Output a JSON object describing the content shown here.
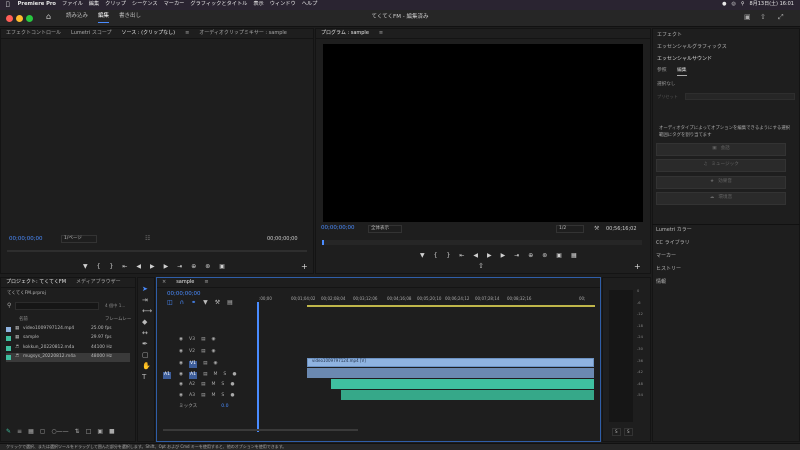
{
  "menubar": {
    "app_name": "Premiere Pro",
    "items": [
      "ファイル",
      "編集",
      "クリップ",
      "シーケンス",
      "マーカー",
      "グラフィックとタイトル",
      "表示",
      "ウィンドウ",
      "ヘルプ"
    ],
    "clock": "8月13日(土) 16:01"
  },
  "titlebar": {
    "tabs": [
      "読み込み",
      "編集",
      "書き出し"
    ],
    "active_tab": "編集",
    "doc_title": "てくてくFM - 編集済み"
  },
  "source_panel": {
    "tabs": [
      "エフェクトコントロール",
      "Lumetri スコープ",
      "ソース : (クリップなし)",
      "オーディオクリップミキサー : sample"
    ],
    "timecode_left": "00;00;00;00",
    "zoom": "1/ページ",
    "timecode_right": "00;00;00;00"
  },
  "program_panel": {
    "tab": "プログラム : sample",
    "timecode_left": "00;00;00;00",
    "fit": "全体表示",
    "resolution": "1/2",
    "timecode_right": "00;56;16;02"
  },
  "right_panel": {
    "headers": [
      "エフェクト",
      "エッセンシャルグラフィックス",
      "エッセンシャルサウンド"
    ],
    "subtabs": [
      "参照",
      "編集"
    ],
    "selection": "選択なし",
    "preset_label": "プリセット",
    "message": "オーディオタイプによってオプションを編集できるようにする選択範囲にタグを割り当てます",
    "buttons": [
      "会話",
      "ミュージック",
      "効果音",
      "環境音"
    ],
    "lower_panels": [
      "Lumetri カラー",
      "CC ライブラリ",
      "マーカー",
      "ヒストリー",
      "情報"
    ]
  },
  "project_panel": {
    "tabs": [
      "プロジェクト: てくてくFM",
      "メディアブラウザー"
    ],
    "file": "てくてくFM.prproj",
    "item_count": "4 個中 1...",
    "columns": [
      "名前",
      "フレームレー"
    ],
    "items": [
      {
        "name": "video1009797124.mp4",
        "rate": "25.00 fps",
        "color": "#8fb3e0"
      },
      {
        "name": "sample",
        "rate": "29.97 fps",
        "color": "#3fc0a0"
      },
      {
        "name": "kokkun_20220812.m4a",
        "rate": "44100 Hz",
        "color": "#3fc0a0"
      },
      {
        "name": "mugsys_20220812.m4a",
        "rate": "48000 Hz",
        "color": "#3fc0a0"
      }
    ]
  },
  "timeline": {
    "tab": "sample",
    "timecode": "00;00;00;00",
    "ruler": [
      ":00;00",
      "00;02;08;04",
      "00;04;16;08",
      "00;06;24;12",
      "00;08;32;16",
      "00;"
    ],
    "ruler_mid": [
      "00;01;04;02",
      "00;03;12;06",
      "00;05;20;10",
      "00;07;28;14"
    ],
    "video_tracks": [
      "V3",
      "V2",
      "V1"
    ],
    "audio_tracks": [
      "A1",
      "A2",
      "A3"
    ],
    "source_patch": [
      "V1",
      "A1"
    ],
    "mix_label": "ミックス",
    "mix_value": "0.0",
    "clip_name": "video1009797124.mp4 [V]"
  },
  "meter": {
    "scale": [
      "0",
      "-6",
      "-12",
      "-18",
      "-24",
      "-30",
      "-36",
      "-42",
      "-48",
      "-54"
    ],
    "buttons": [
      "S",
      "S"
    ]
  },
  "statusbar": {
    "text": "クリックで選択、または選択ツールをドラッグして囲んだ部分を選択します。Shift、Opt および Cmd キーを使用すると、他のオプションを使用できます。"
  },
  "colors": {
    "accent": "#4a8cff",
    "video_clip": "#8fb3e0",
    "audio_clip": "#3fc0a0"
  }
}
